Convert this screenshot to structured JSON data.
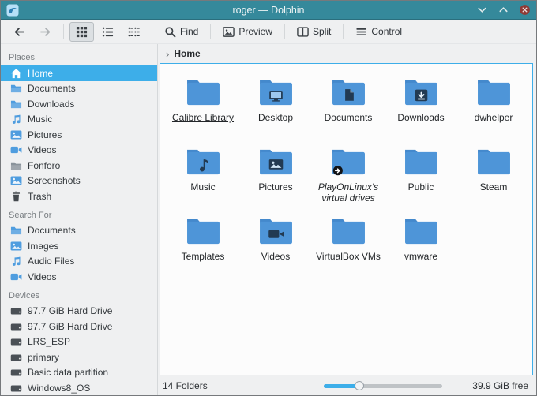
{
  "window": {
    "title": "roger — Dolphin"
  },
  "titlebar_controls": {
    "minimize_icon": "chevron-down",
    "maximize_icon": "chevron-up",
    "close_icon": "circle-x"
  },
  "toolbar": {
    "find_label": "Find",
    "preview_label": "Preview",
    "split_label": "Split",
    "control_label": "Control",
    "selected_view_mode": "icons"
  },
  "breadcrumb": {
    "chevron": "›",
    "location": "Home"
  },
  "sidebar": {
    "places": {
      "title": "Places",
      "items": [
        {
          "label": "Home",
          "icon": "home-icon",
          "selected": true
        },
        {
          "label": "Documents",
          "icon": "folder-icon"
        },
        {
          "label": "Downloads",
          "icon": "folder-icon"
        },
        {
          "label": "Music",
          "icon": "music-note-icon"
        },
        {
          "label": "Pictures",
          "icon": "image-icon"
        },
        {
          "label": "Videos",
          "icon": "video-icon"
        },
        {
          "label": "Fonforo",
          "icon": "folder-icon"
        },
        {
          "label": "Screenshots",
          "icon": "image-icon"
        },
        {
          "label": "Trash",
          "icon": "trash-icon"
        }
      ]
    },
    "search_for": {
      "title": "Search For",
      "items": [
        {
          "label": "Documents",
          "icon": "folder-icon"
        },
        {
          "label": "Images",
          "icon": "image-icon"
        },
        {
          "label": "Audio Files",
          "icon": "music-note-icon"
        },
        {
          "label": "Videos",
          "icon": "video-icon"
        }
      ]
    },
    "devices": {
      "title": "Devices",
      "items": [
        {
          "label": "97.7 GiB Hard Drive",
          "icon": "hard-drive-icon"
        },
        {
          "label": "97.7 GiB Hard Drive",
          "icon": "hard-drive-icon"
        },
        {
          "label": "LRS_ESP",
          "icon": "hard-drive-icon"
        },
        {
          "label": "primary",
          "icon": "hard-drive-icon"
        },
        {
          "label": "Basic data partition",
          "icon": "hard-drive-icon"
        },
        {
          "label": "Windows8_OS",
          "icon": "hard-drive-icon"
        }
      ]
    }
  },
  "grid": {
    "folders": [
      {
        "label": "Calibre Library",
        "emblem": "none",
        "selected": true
      },
      {
        "label": "Desktop",
        "emblem": "desktop"
      },
      {
        "label": "Documents",
        "emblem": "document"
      },
      {
        "label": "Downloads",
        "emblem": "download"
      },
      {
        "label": "dwhelper",
        "emblem": "none"
      },
      {
        "label": "Music",
        "emblem": "music"
      },
      {
        "label": "Pictures",
        "emblem": "picture"
      },
      {
        "label": "PlayOnLinux's virtual drives",
        "emblem": "none",
        "symlink": true,
        "italic": true
      },
      {
        "label": "Public",
        "emblem": "none"
      },
      {
        "label": "Steam",
        "emblem": "none"
      },
      {
        "label": "Templates",
        "emblem": "none"
      },
      {
        "label": "Videos",
        "emblem": "video"
      },
      {
        "label": "VirtualBox VMs",
        "emblem": "none"
      },
      {
        "label": "vmware",
        "emblem": "none"
      }
    ]
  },
  "statusbar": {
    "left_text": "14 Folders",
    "right_text": "39.9 GiB free",
    "zoom_percent": 30
  },
  "colors": {
    "accent": "#3daee9",
    "titlebar": "#35899b",
    "folder_front": "#79b1e2",
    "folder_back": "#4e95d8",
    "emblem": "#223a52"
  }
}
